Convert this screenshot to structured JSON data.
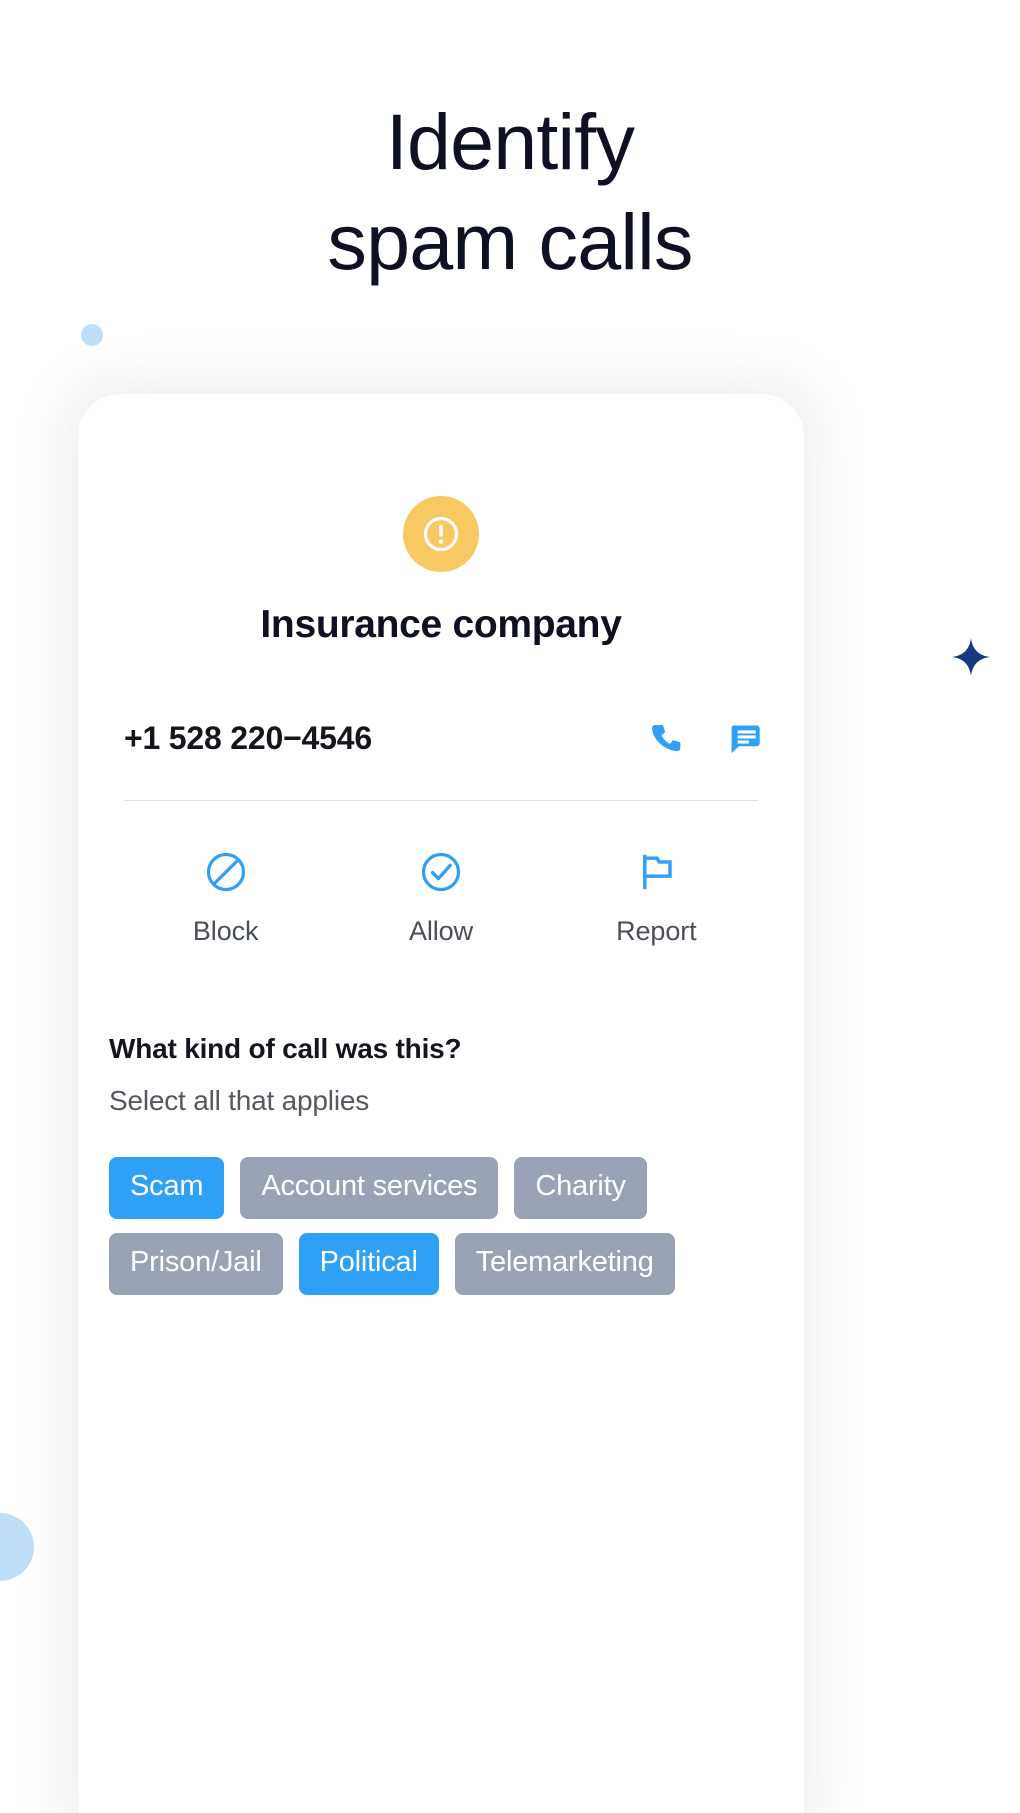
{
  "hero": {
    "line1": "Identify",
    "line2": "spam calls"
  },
  "card": {
    "status_icon": "warning-exclamation-icon",
    "caller_name": "Insurance company",
    "phone_number": "+1 528 220−4546",
    "number_actions": [
      {
        "name": "call-button",
        "icon": "phone-icon"
      },
      {
        "name": "message-button",
        "icon": "message-bubble-icon"
      }
    ],
    "actions": [
      {
        "label": "Block",
        "icon": "block-circle-slash-icon"
      },
      {
        "label": "Allow",
        "icon": "check-circle-icon"
      },
      {
        "label": "Report",
        "icon": "flag-icon"
      }
    ],
    "survey": {
      "question": "What kind of call was this?",
      "subtitle": "Select all that applies",
      "chips": [
        {
          "label": "Scam",
          "selected": true
        },
        {
          "label": "Account services",
          "selected": false
        },
        {
          "label": "Charity",
          "selected": false
        },
        {
          "label": "Prison/Jail",
          "selected": false
        },
        {
          "label": "Political",
          "selected": true
        },
        {
          "label": "Telemarketing",
          "selected": false
        }
      ]
    }
  },
  "colors": {
    "accent_blue": "#2ea0f5",
    "warning_amber": "#f8c963",
    "chip_unselected": "#9aa3b5",
    "heading_navy": "#0d1122",
    "deco_light_blue": "#bfdff8",
    "deco_star_navy": "#14397d"
  },
  "decorations": [
    {
      "name": "decor-dot-left",
      "shape": "circle"
    },
    {
      "name": "decor-star-right",
      "shape": "four-point-star"
    },
    {
      "name": "decor-blob-left-edge",
      "shape": "circle"
    }
  ]
}
